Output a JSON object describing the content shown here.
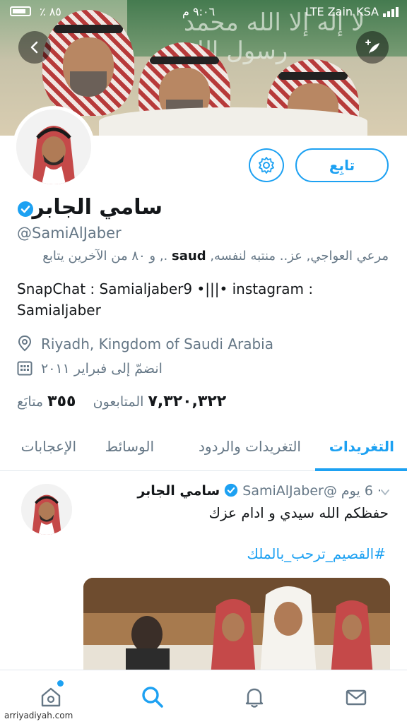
{
  "status_bar": {
    "carrier": "Zain KSA",
    "network": "LTE",
    "time": "٩:٠٦ م",
    "battery": "٪ ٨٥"
  },
  "banner": {
    "calligraphy": "لا إله إلا الله محمد رسول الله"
  },
  "profile": {
    "name": "سامي الجابر",
    "handle": "@SamiAlJaber",
    "followed_by_prefix": "مرعي العواجي, عز.. منتبه لنفسه,",
    "followed_by_bold": "saud",
    "followed_by_suffix": "., و ٨٠ من الآخرين يتابع",
    "bio": "SnapChat : Samialjaber9 •|||• instagram : Samialjaber",
    "location": "Riyadh, Kingdom of Saudi Arabia",
    "joined": "انضمّ إلى فبراير ٢٠١١",
    "followers_count": "٧,٣٢٠,٣٢٢",
    "followers_label": "المتابعون",
    "following_count": "٣٥٥",
    "following_label": "متابَع",
    "follow_label": "تابِع"
  },
  "tabs": [
    {
      "label": "التغريدات"
    },
    {
      "label": "التغريدات والردود"
    },
    {
      "label": "الوسائط"
    },
    {
      "label": "الإعجابات"
    }
  ],
  "tweet": {
    "name": "سامي الجابر",
    "handle": "@SamiAlJaber",
    "time": "· 6 يوم",
    "text": "حفظكم الله سيدي و ادام عزك",
    "hashtag": "#القصيم_ترحب_بالملك"
  },
  "watermark": "arriyadiyah.com",
  "colors": {
    "accent": "#1da1f2",
    "secondary_text": "#657786"
  },
  "icons": {
    "back": "chevron-left-icon",
    "compose": "compose-icon",
    "settings": "gear-icon",
    "verified": "verified-badge-icon",
    "location": "location-pin-icon",
    "calendar": "calendar-icon",
    "home": "home-icon",
    "search": "search-icon",
    "notifications": "bell-icon",
    "messages": "mail-icon"
  }
}
